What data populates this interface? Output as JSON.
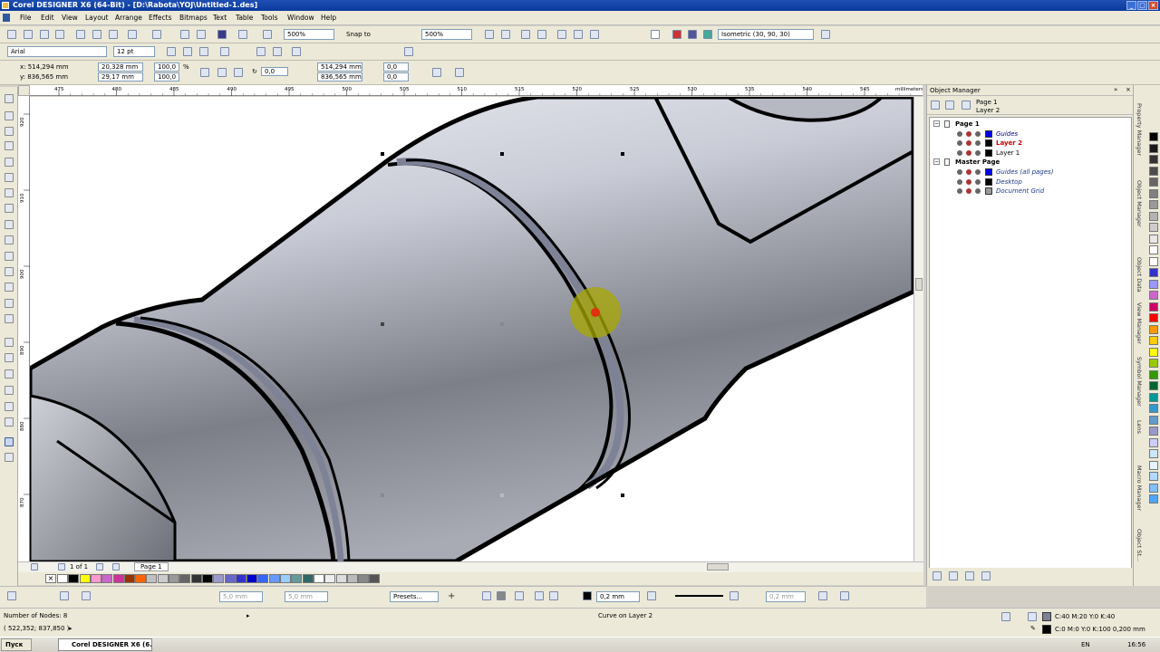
{
  "window": {
    "title": "Corel DESIGNER X6 (64-Bit) - [D:\\Rabota\\YOJ\\Untitled-1.des]"
  },
  "menu": [
    "File",
    "Edit",
    "View",
    "Layout",
    "Arrange",
    "Effects",
    "Bitmaps",
    "Text",
    "Table",
    "Tools",
    "Window",
    "Help"
  ],
  "toolbar": {
    "zoom_level": "500%",
    "snap_to": "Snap to",
    "zoom_level_2": "500%",
    "projection": "Isometric (30, 90, 30)"
  },
  "font_bar": {
    "font_name": "Arial",
    "font_size": "12 pt"
  },
  "property_bar": {
    "x": "x: 514,294 mm",
    "y": "y: 836,565 mm",
    "width": "20,328 mm",
    "height": "29,17 mm",
    "scale_w": "100,0",
    "scale_h": "100,0",
    "pct": "%",
    "angle": "0,0",
    "cx": "514,294 mm",
    "cy": "836,565 mm",
    "skew1": "0,0",
    "skew2": "0,0"
  },
  "ruler": {
    "h_ticks": [
      "475",
      "480",
      "485",
      "490",
      "495",
      "500",
      "505",
      "510",
      "515",
      "520",
      "525",
      "530",
      "535",
      "540",
      "545"
    ],
    "units": "millimeters",
    "v_ticks": [
      "920",
      "910",
      "900",
      "890",
      "880",
      "870"
    ]
  },
  "page_nav": {
    "counter": "1 of 1",
    "page_tab": "Page 1"
  },
  "palette_colors": [
    "#ffffff",
    "#000000",
    "#ffff00",
    "#ff99cc",
    "#cc66cc",
    "#cc3399",
    "#993300",
    "#ff6600",
    "#c0c0c0",
    "#cccccc",
    "#999999",
    "#666666",
    "#333333",
    "#000000",
    "#9999cc",
    "#6666cc",
    "#3333cc",
    "#0000cc",
    "#3366ff",
    "#6699ff",
    "#99ccff",
    "#669999",
    "#336666",
    "#ffffff",
    "#eeeeee",
    "#dddddd",
    "#bbbbbb",
    "#888888",
    "#555555"
  ],
  "bottom_bar": {
    "size1": "5,0 mm",
    "size2": "5,0 mm",
    "presets": "Presets...",
    "outline_width": "0,2 mm",
    "outline_width2": "0,2 mm"
  },
  "status": {
    "nodes": "Number of Nodes: 8",
    "coords": "( 522,352; 837,850 )",
    "object_info": "Curve on Layer 2",
    "fill_info": "C:40 M:20 Y:0 K:40",
    "outline_info": "C:0 M:0 Y:0 K:100  0,200 mm"
  },
  "object_manager": {
    "title": "Object Manager",
    "header_page": "Page 1",
    "header_layer": "Layer 2",
    "rows": [
      {
        "label": "Page 1",
        "indent": 0,
        "bold": true,
        "color": "#000000"
      },
      {
        "label": "Guides",
        "indent": 1,
        "italic": true,
        "color": "#000080"
      },
      {
        "label": "Layer 2",
        "indent": 1,
        "bold": true,
        "color": "#cc0000"
      },
      {
        "label": "Layer 1",
        "indent": 1,
        "color": "#000000"
      },
      {
        "label": "Master Page",
        "indent": 0,
        "bold": true,
        "color": "#000000"
      },
      {
        "label": "Guides (all pages)",
        "indent": 1,
        "italic": true,
        "color": "#1a3a8a"
      },
      {
        "label": "Desktop",
        "indent": 1,
        "italic": true,
        "color": "#1a3a8a"
      },
      {
        "label": "Document Grid",
        "indent": 1,
        "italic": true,
        "color": "#1a3a8a"
      }
    ]
  },
  "docker_tabs": [
    "Property Manager",
    "Object Manager",
    "Object Data",
    "View Manager",
    "Symbol Manager",
    "Lens",
    "Macro Manager",
    "Object St..."
  ],
  "side_palette": [
    "#000000",
    "#1a1a1a",
    "#333333",
    "#4d4d4d",
    "#666666",
    "#808080",
    "#999999",
    "#b3b3b3",
    "#cccccc",
    "#e6e6e6",
    "#ffffff",
    "#ffffff",
    "#3333cc",
    "#9999ff",
    "#cc66cc",
    "#cc0066",
    "#ff0000",
    "#ff9900",
    "#ffcc00",
    "#ffff00",
    "#99cc00",
    "#339900",
    "#006633",
    "#009999",
    "#3399cc",
    "#6699cc",
    "#9999cc",
    "#ccccff",
    "#cce6ff",
    "#e6f2ff",
    "#b3d9ff",
    "#80bfff",
    "#4da6ff"
  ],
  "taskbar": {
    "start": "Пуск",
    "app": "Corel DESIGNER X6 (6...",
    "lang": "EN",
    "clock": "16:56"
  }
}
